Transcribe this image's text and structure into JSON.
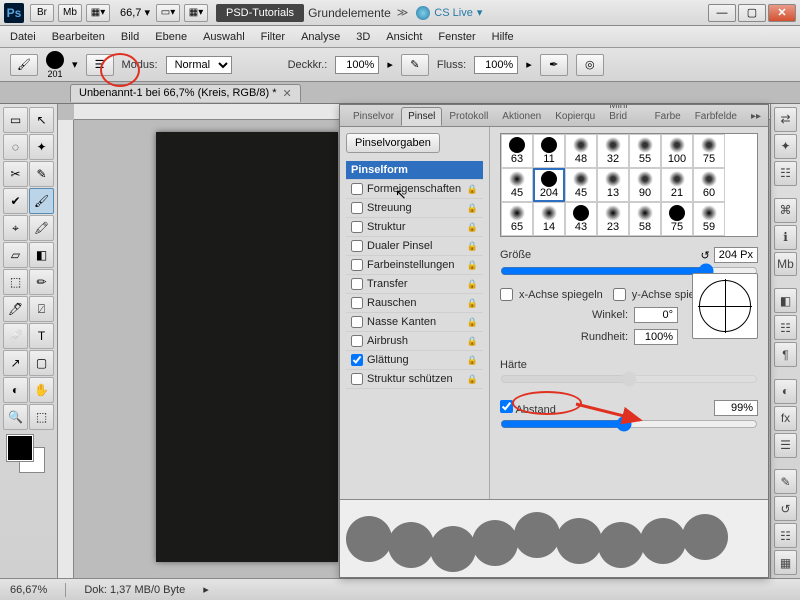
{
  "title": {
    "psd_tut": "PSD-Tutorials",
    "grund": "Grundelemente",
    "cslive": "CS Live",
    "zoom": "66,7",
    "br": "Br",
    "mb": "Mb"
  },
  "menu": [
    "Datei",
    "Bearbeiten",
    "Bild",
    "Ebene",
    "Auswahl",
    "Filter",
    "Analyse",
    "3D",
    "Ansicht",
    "Fenster",
    "Hilfe"
  ],
  "opt": {
    "size_label": "201",
    "modus_lbl": "Modus:",
    "modus_val": "Normal",
    "deckk": "Deckkr.:",
    "deckk_val": "100%",
    "fluss": "Fluss:",
    "fluss_val": "100%"
  },
  "doc": {
    "tab": "Unbenannt-1 bei 66,7% (Kreis, RGB/8) *"
  },
  "panel": {
    "tabs": [
      "Pinselvor",
      "Pinsel",
      "Protokoll",
      "Aktionen",
      "Kopierqu",
      "Mini Brid",
      "Farbe",
      "Farbfelde"
    ],
    "active_tab": "Pinsel",
    "vorgaben": "Pinselvorgaben",
    "cats": [
      {
        "label": "Pinselform",
        "hdr": true
      },
      {
        "label": "Formeigenschaften",
        "chk": false,
        "lock": true
      },
      {
        "label": "Streuung",
        "chk": false,
        "lock": true
      },
      {
        "label": "Struktur",
        "chk": false,
        "lock": true
      },
      {
        "label": "Dualer Pinsel",
        "chk": false,
        "lock": true
      },
      {
        "label": "Farbeinstellungen",
        "chk": false,
        "lock": true
      },
      {
        "label": "Transfer",
        "chk": false,
        "lock": true
      },
      {
        "label": "Rauschen",
        "chk": false,
        "lock": true
      },
      {
        "label": "Nasse Kanten",
        "chk": false,
        "lock": true
      },
      {
        "label": "Airbrush",
        "chk": false,
        "lock": true
      },
      {
        "label": "Glättung",
        "chk": true,
        "lock": true
      },
      {
        "label": "Struktur schützen",
        "chk": false,
        "lock": true
      }
    ],
    "grid_rows": [
      [
        63,
        11,
        48,
        32,
        55,
        100,
        75
      ],
      [
        45,
        204,
        45,
        13,
        90,
        21,
        60
      ],
      [
        65,
        14,
        43,
        23,
        58,
        75,
        59
      ]
    ],
    "selected_tip": 204,
    "grosse_lbl": "Größe",
    "grosse_val": "204 Px",
    "xflip": "x-Achse spiegeln",
    "yflip": "y-Achse spiegeln",
    "winkel": "Winkel:",
    "winkel_val": "0°",
    "rund": "Rundheit:",
    "rund_val": "100%",
    "harte": "Härte",
    "abstand": "Abstand",
    "abstand_val": "99%"
  },
  "status": {
    "zoom": "66,67%",
    "dok": "Dok: 1,37 MB/0 Byte"
  }
}
